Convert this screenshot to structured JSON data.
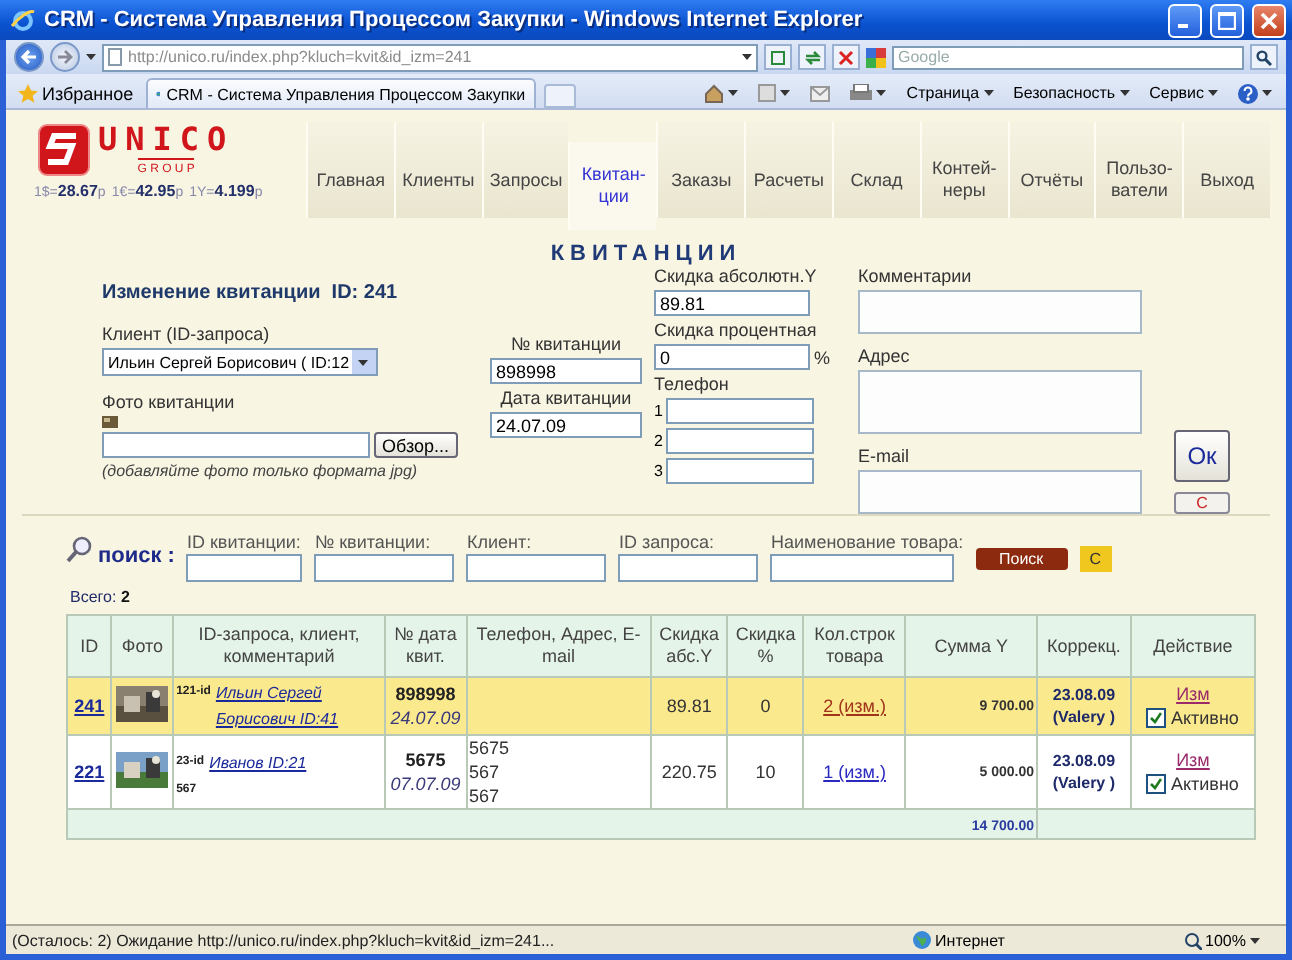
{
  "window": {
    "title": "CRM - Система Управления Процессом Закупки - Windows Internet Explorer"
  },
  "address_bar": {
    "url": "http://unico.ru/index.php?kluch=kvit&id_izm=241"
  },
  "web_search": {
    "placeholder": "Google"
  },
  "favorites": {
    "label": "Избранное"
  },
  "browser_tab": {
    "title": "CRM - Система Управления Процессом Закупки"
  },
  "command_menus": [
    "Страница",
    "Безопасность",
    "Сервис"
  ],
  "logo": {
    "name": "UNICO",
    "tagline": "G R O U P"
  },
  "rates": [
    {
      "label": "1$=",
      "value": "28.67",
      "unit": "р"
    },
    {
      "label": "1€=",
      "value": "42.95",
      "unit": "р"
    },
    {
      "label": "1Y=",
      "value": "4.199",
      "unit": "р"
    }
  ],
  "nav": [
    {
      "label": "Главная",
      "selected": false
    },
    {
      "label": "Клиенты",
      "selected": false
    },
    {
      "label": "Запросы",
      "selected": false
    },
    {
      "label": "Квитан-\nции",
      "selected": true
    },
    {
      "label": "Заказы",
      "selected": false
    },
    {
      "label": "Расчеты",
      "selected": false
    },
    {
      "label": "Склад",
      "selected": false
    },
    {
      "label": "Контей-\nнеры",
      "selected": false
    },
    {
      "label": "Отчёты",
      "selected": false
    },
    {
      "label": "Пользо-\nватели",
      "selected": false
    },
    {
      "label": "Выход",
      "selected": false
    }
  ],
  "page_title": "КВИТАНЦИИ",
  "form": {
    "heading": "Изменение квитанции  ID: 241",
    "client": {
      "label": "Клиент (ID-запроса)",
      "value": "Ильин Сергей Борисович ( ID:12"
    },
    "photo": {
      "label": "Фото квитанции",
      "button": "Обзор...",
      "hint": "(добавляйте фото только формата jpg)"
    },
    "receipt_number": {
      "label": "№ квитанции",
      "value": "898998"
    },
    "receipt_date": {
      "label": "Дата квитанции",
      "value": "24.07.09"
    },
    "discount_abs": {
      "label": "Скидка абсолютн.Y",
      "value": "89.81"
    },
    "discount_pct": {
      "label": "Скидка процентная",
      "value": "0",
      "unit": "%"
    },
    "phones": {
      "label": "Телефон",
      "lines": [
        "1",
        "2",
        "3"
      ]
    },
    "comments": {
      "label": "Комментарии"
    },
    "address": {
      "label": "Адрес"
    },
    "email": {
      "label": "E-mail"
    },
    "ok": "Ок",
    "cancel": "С"
  },
  "search": {
    "label": "поиск :",
    "fields": [
      "ID квитанции:",
      "№ квитанции:",
      "Клиент:",
      "ID запроса:",
      "Наименование товара:"
    ],
    "button": "Поиск",
    "reset": "С"
  },
  "total": {
    "label": "Всего:",
    "value": "2"
  },
  "table": {
    "columns": [
      "ID",
      "Фото",
      "ID-запроса, клиент, комментарий",
      "№ дата квит.",
      "Телефон, Адрес, E-mail",
      "Скидка абс.Y",
      "Скидка %",
      "Кол.строк товара",
      "Сумма Y",
      "Коррекц.",
      "Действие"
    ],
    "rows": [
      {
        "selected": true,
        "id": "241",
        "request_id": "121-id",
        "client": "Ильин Сергей Борисович ID:41",
        "comment": "",
        "number": "898998",
        "date": "24.07.09",
        "contacts": [],
        "discount_abs": "89.81",
        "discount_pct": "0",
        "lines": "2 (изм.)",
        "sum": "9 700.00",
        "corrected": "23.08.09",
        "corrected_by": "(Valery )",
        "edit": "Изм",
        "active": {
          "label": "Активно",
          "checked": true
        }
      },
      {
        "selected": false,
        "id": "221",
        "request_id": "23-id",
        "client": "Иванов ID:21",
        "comment": "567",
        "number": "5675",
        "date": "07.07.09",
        "contacts": [
          "5675",
          "567",
          "567"
        ],
        "discount_abs": "220.75",
        "discount_pct": "10",
        "lines": "1 (изм.)",
        "sum": "5 000.00",
        "corrected": "23.08.09",
        "corrected_by": "(Valery )",
        "edit": "Изм",
        "active": {
          "label": "Активно",
          "checked": true
        }
      }
    ],
    "grand_total": "14 700.00"
  },
  "status_bar": {
    "text": "(Осталось: 2) Ожидание http://unico.ru/index.php?kluch=kvit&id_izm=241...",
    "zone": "Интернет",
    "zoom": "100%"
  }
}
